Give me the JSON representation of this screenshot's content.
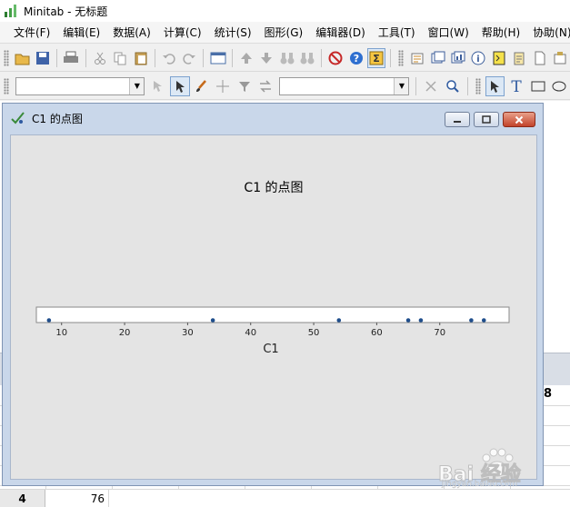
{
  "app": {
    "title": "Minitab - 无标题"
  },
  "menu": [
    "文件(F)",
    "编辑(E)",
    "数据(A)",
    "计算(C)",
    "统计(S)",
    "图形(G)",
    "编辑器(D)",
    "工具(T)",
    "窗口(W)",
    "帮助(H)",
    "协助(N)"
  ],
  "graph_window": {
    "title": "C1 的点图"
  },
  "chart_data": {
    "type": "scatter",
    "title": "C1 的点图",
    "xlabel": "C1",
    "ylabel": "",
    "xticks": [
      10,
      20,
      30,
      40,
      50,
      60,
      70
    ],
    "xlim": [
      6,
      81
    ],
    "grid": false,
    "x": [
      8,
      34,
      54,
      65,
      67,
      75,
      77
    ]
  },
  "worksheet": {
    "column_header_partial": "8",
    "row": {
      "num": "4",
      "c1_value": "76"
    }
  },
  "watermark": {
    "text": "Bai 经验",
    "sub": "jingyan.baidu.com"
  },
  "colors": {
    "marker": "#1f4e8c",
    "plot_bg": "#e4e4e4",
    "window_frame": "#c9d7ea"
  }
}
